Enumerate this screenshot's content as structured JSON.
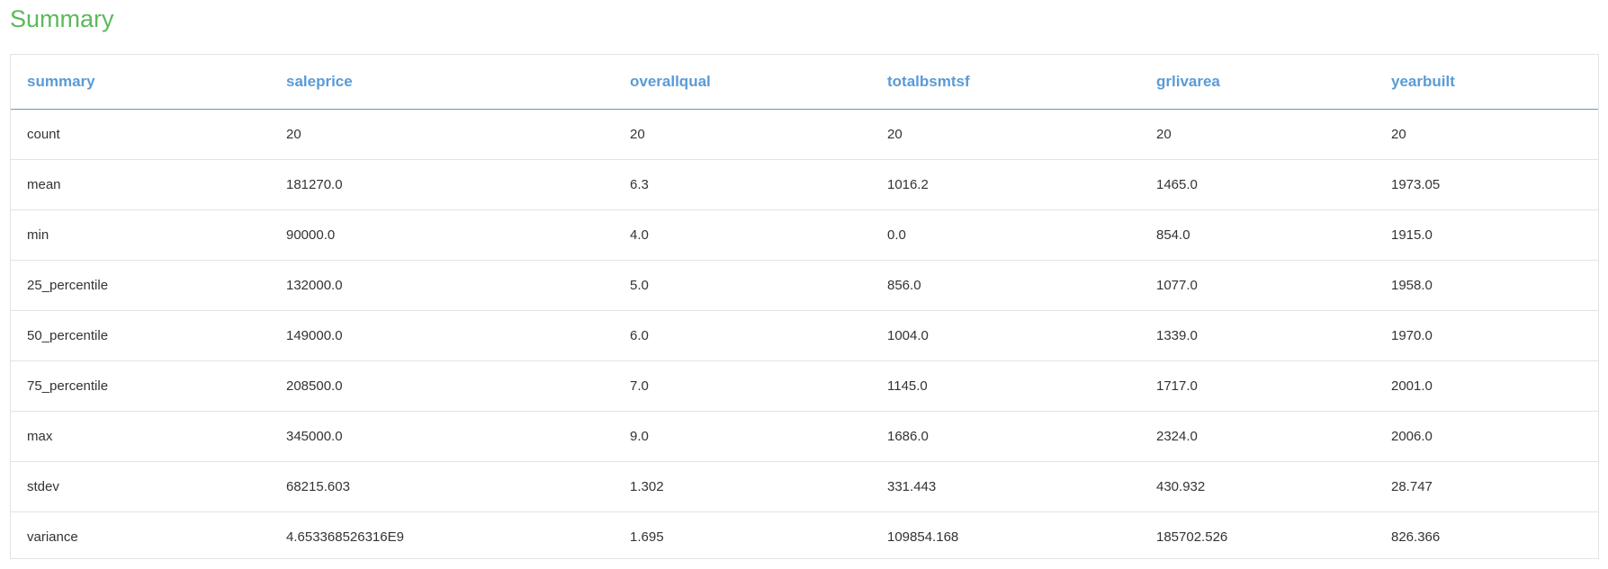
{
  "page": {
    "title": "Summary"
  },
  "table": {
    "headers": [
      "summary",
      "saleprice",
      "overallqual",
      "totalbsmtsf",
      "grlivarea",
      "yearbuilt"
    ],
    "rows": [
      [
        "count",
        "20",
        "20",
        "20",
        "20",
        "20"
      ],
      [
        "mean",
        "181270.0",
        "6.3",
        "1016.2",
        "1465.0",
        "1973.05"
      ],
      [
        "min",
        "90000.0",
        "4.0",
        "0.0",
        "854.0",
        "1915.0"
      ],
      [
        "25_percentile",
        "132000.0",
        "5.0",
        "856.0",
        "1077.0",
        "1958.0"
      ],
      [
        "50_percentile",
        "149000.0",
        "6.0",
        "1004.0",
        "1339.0",
        "1970.0"
      ],
      [
        "75_percentile",
        "208500.0",
        "7.0",
        "1145.0",
        "1717.0",
        "2001.0"
      ],
      [
        "max",
        "345000.0",
        "9.0",
        "1686.0",
        "2324.0",
        "2006.0"
      ],
      [
        "stdev",
        "68215.603",
        "1.302",
        "331.443",
        "430.932",
        "28.747"
      ],
      [
        "variance",
        "4.653368526316E9",
        "1.695",
        "109854.168",
        "185702.526",
        "826.366"
      ]
    ]
  }
}
